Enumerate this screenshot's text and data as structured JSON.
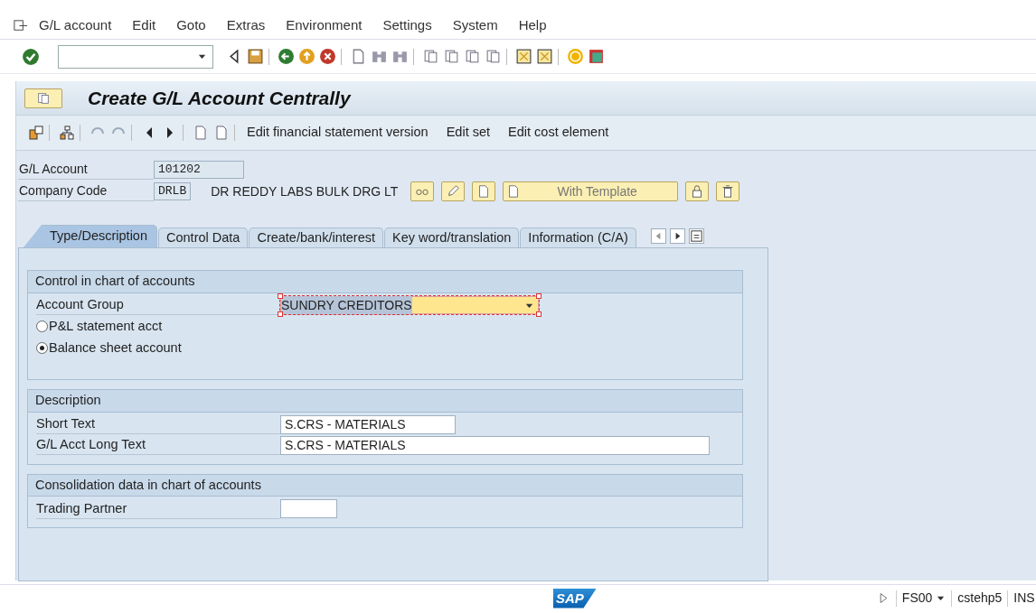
{
  "menu": [
    {
      "label": "G/L account"
    },
    {
      "label": "Edit"
    },
    {
      "label": "Goto"
    },
    {
      "label": "Extras"
    },
    {
      "label": "Environment"
    },
    {
      "label": "Settings"
    },
    {
      "label": "System"
    },
    {
      "label": "Help"
    }
  ],
  "title": "Create G/L Account Centrally",
  "app_toolbar": [
    {
      "label": "Edit financial statement version"
    },
    {
      "label": "Edit set"
    },
    {
      "label": "Edit cost element"
    }
  ],
  "header": {
    "gl_account": {
      "label": "G/L Account",
      "value": "101202"
    },
    "company_code": {
      "label": "Company Code",
      "value": "DRLB",
      "name": "DR REDDY LABS BULK DRG LT"
    },
    "template_button": "With Template"
  },
  "tabs": [
    {
      "label": "Type/Description",
      "selected": true
    },
    {
      "label": "Control Data",
      "selected": false
    },
    {
      "label": "Create/bank/interest",
      "selected": false
    },
    {
      "label": "Key word/translation",
      "selected": false
    },
    {
      "label": "Information (C/A)",
      "selected": false
    }
  ],
  "groups": [
    {
      "title": "Control in chart of accounts",
      "rows": [
        {
          "kind": "dropdown",
          "label": "Account Group",
          "value": "SUNDRY CREDITORS",
          "focused": true
        },
        {
          "kind": "radio",
          "label": "P&L statement acct",
          "selected": false
        },
        {
          "kind": "radio",
          "label": "Balance sheet account",
          "selected": true
        }
      ]
    },
    {
      "title": "Description",
      "rows": [
        {
          "kind": "shortfield",
          "label": "Short Text",
          "value": "S.CRS - MATERIALS"
        },
        {
          "kind": "longfield",
          "label": "G/L Acct Long Text",
          "value": "S.CRS - MATERIALS"
        }
      ]
    },
    {
      "title": "Consolidation data in chart of accounts",
      "rows": [
        {
          "kind": "tinyfield",
          "label": "Trading Partner"
        }
      ]
    }
  ],
  "status_bar": {
    "logo": "SAP",
    "transaction": "FS00",
    "server": "cstehp5",
    "mode": "INS"
  }
}
